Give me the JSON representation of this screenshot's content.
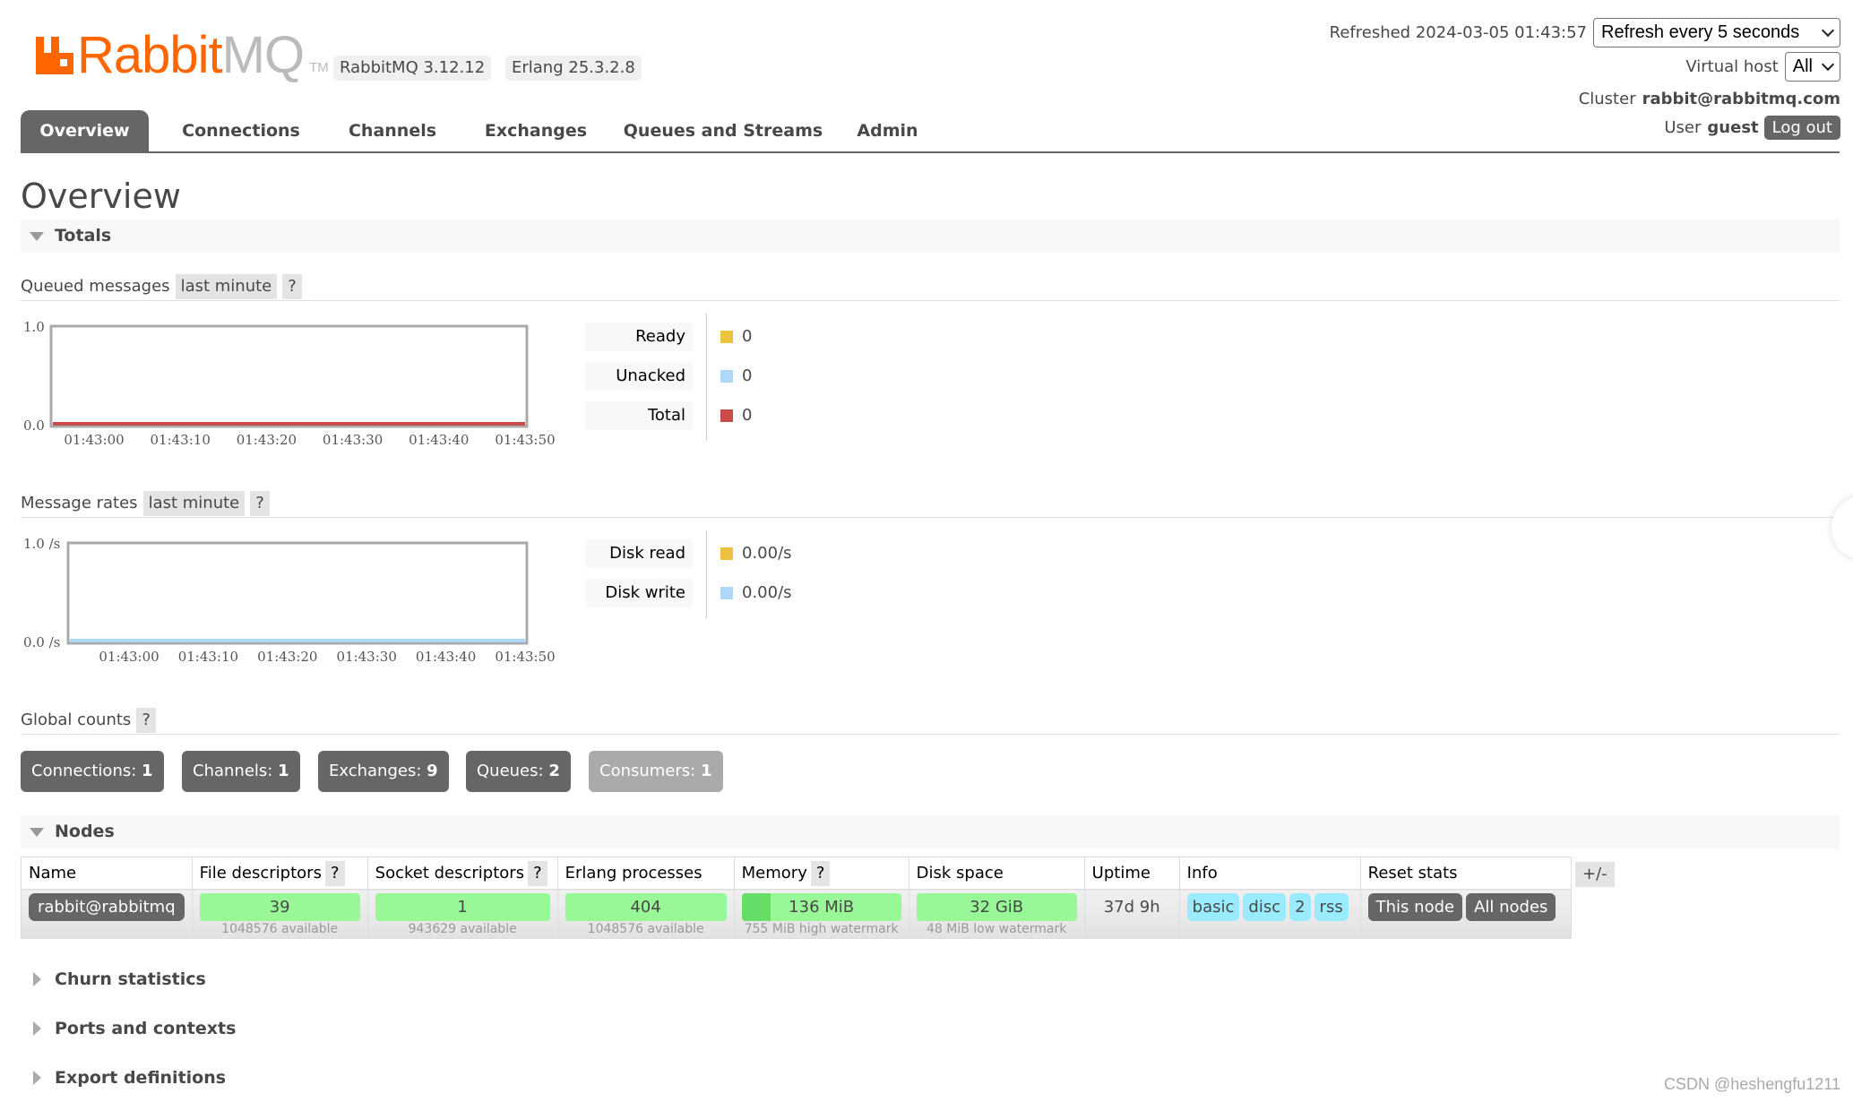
{
  "header": {
    "logo_brand": "Rabbit",
    "logo_suffix": "MQ",
    "logo_tm": "TM",
    "versions": [
      "RabbitMQ 3.12.12",
      "Erlang 25.3.2.8"
    ],
    "refreshed_label": "Refreshed 2024-03-05 01:43:57",
    "refresh_select": "Refresh every 5 seconds",
    "vhost_label": "Virtual host",
    "vhost_select": "All",
    "cluster_label": "Cluster",
    "cluster_name": "rabbit@rabbitmq.com",
    "user_label": "User",
    "user_name": "guest",
    "logout": "Log out"
  },
  "tabs": [
    {
      "label": "Overview",
      "active": true
    },
    {
      "label": "Connections",
      "active": false
    },
    {
      "label": "Channels",
      "active": false
    },
    {
      "label": "Exchanges",
      "active": false
    },
    {
      "label": "Queues and Streams",
      "active": false
    },
    {
      "label": "Admin",
      "active": false
    }
  ],
  "page_title": "Overview",
  "totals": {
    "title": "Totals",
    "queued": {
      "label": "Queued messages",
      "range": "last minute",
      "help": "?"
    },
    "rates": {
      "label": "Message rates",
      "range": "last minute",
      "help": "?"
    },
    "global": {
      "label": "Global counts",
      "help": "?",
      "counts": [
        {
          "label": "Connections:",
          "value": "1"
        },
        {
          "label": "Channels:",
          "value": "1"
        },
        {
          "label": "Exchanges:",
          "value": "9"
        },
        {
          "label": "Queues:",
          "value": "2"
        },
        {
          "label": "Consumers:",
          "value": "1"
        }
      ]
    }
  },
  "chart_data": [
    {
      "type": "line",
      "title": "Queued messages",
      "x": [
        "01:43:00",
        "01:43:10",
        "01:43:20",
        "01:43:30",
        "01:43:40",
        "01:43:50"
      ],
      "ytick_labels": [
        "1.0",
        "0.0"
      ],
      "ylim": [
        0,
        1
      ],
      "series": [
        {
          "name": "Ready",
          "color": "#edc240",
          "values": [
            0,
            0,
            0,
            0,
            0,
            0
          ],
          "display": "0"
        },
        {
          "name": "Unacked",
          "color": "#afd8f8",
          "values": [
            0,
            0,
            0,
            0,
            0,
            0
          ],
          "display": "0"
        },
        {
          "name": "Total",
          "color": "#cb4b4b",
          "values": [
            0,
            0,
            0,
            0,
            0,
            0
          ],
          "display": "0"
        }
      ]
    },
    {
      "type": "line",
      "title": "Message rates",
      "x": [
        "01:43:00",
        "01:43:10",
        "01:43:20",
        "01:43:30",
        "01:43:40",
        "01:43:50"
      ],
      "ytick_labels": [
        "1.0 /s",
        "0.0 /s"
      ],
      "ylim": [
        0,
        1
      ],
      "series": [
        {
          "name": "Disk read",
          "color": "#edc240",
          "values": [
            0,
            0,
            0,
            0,
            0,
            0
          ],
          "display": "0.00/s"
        },
        {
          "name": "Disk write",
          "color": "#afd8f8",
          "values": [
            0,
            0,
            0,
            0,
            0,
            0
          ],
          "display": "0.00/s"
        }
      ]
    }
  ],
  "nodes": {
    "title": "Nodes",
    "columns": [
      {
        "label": "Name",
        "help": false
      },
      {
        "label": "File descriptors",
        "help": true
      },
      {
        "label": "Socket descriptors",
        "help": true
      },
      {
        "label": "Erlang processes",
        "help": false
      },
      {
        "label": "Memory",
        "help": true
      },
      {
        "label": "Disk space",
        "help": false
      },
      {
        "label": "Uptime",
        "help": false
      },
      {
        "label": "Info",
        "help": false
      },
      {
        "label": "Reset stats",
        "help": false
      }
    ],
    "help": "?",
    "toggle_columns": "+/-",
    "rows": [
      {
        "name": "rabbit@rabbitmq",
        "file_descriptors": {
          "value": "39",
          "sub": "1048576 available",
          "fraction": 4e-05
        },
        "socket_descriptors": {
          "value": "1",
          "sub": "943629 available",
          "fraction": 1e-06
        },
        "erlang_processes": {
          "value": "404",
          "sub": "1048576 available",
          "fraction": 0.0004
        },
        "memory": {
          "value": "136 MiB",
          "sub": "755 MiB high watermark",
          "fraction": 0.18
        },
        "disk_space": {
          "value": "32 GiB",
          "sub": "48 MiB low watermark"
        },
        "uptime": "37d 9h",
        "info": [
          "basic",
          "disc",
          "2",
          "rss"
        ],
        "reset": [
          "This node",
          "All nodes"
        ]
      }
    ]
  },
  "collapsed_sections": [
    "Churn statistics",
    "Ports and contexts",
    "Export definitions"
  ],
  "watermark": "CSDN @heshengfu1211"
}
